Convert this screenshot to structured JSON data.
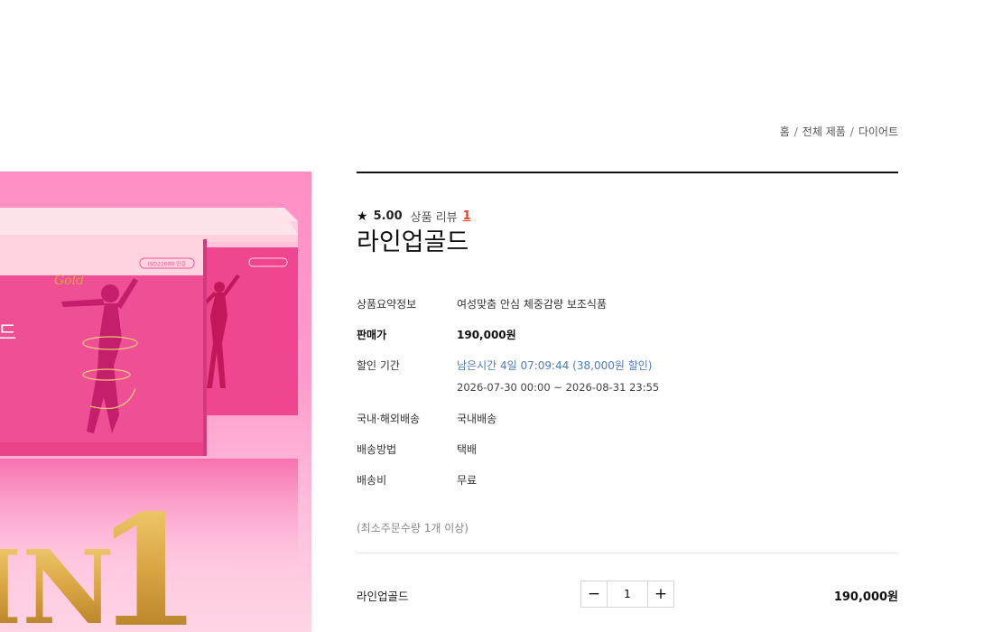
{
  "breadcrumb": [
    "홈",
    "전체 제품",
    "다이어트"
  ],
  "product": {
    "rating": "5.00",
    "review_label": "상품 리뷰",
    "review_count": "1",
    "title": "라인업골드"
  },
  "info_rows": [
    {
      "label": "상품요약정보",
      "value": "여성맞춤 안심 체중감량 보조식품"
    },
    {
      "label": "판매가",
      "value": "190,000원"
    },
    {
      "label": "할인 기간",
      "value": "남은시간 4일 07:09:44 (38,000원 할인)",
      "sub": "2026-07-30 00:00 ~ 2026-08-31 23:55"
    },
    {
      "label": "국내·해외배송",
      "value": "국내배송"
    },
    {
      "label": "배송방법",
      "value": "택배"
    },
    {
      "label": "배송비",
      "value": "무료"
    }
  ],
  "min_order": "(최소주문수량 1개 이상)",
  "option": {
    "name": "라인업골드",
    "quantity": "1",
    "minus": "−",
    "plus": "+",
    "price": "190,000원"
  },
  "image_texts": {
    "box_certified": "ISO22000 인증",
    "gold_mark": "Gold",
    "side_char": "드",
    "big_text": "IN",
    "big_number": "1"
  },
  "colors": {
    "accent_red": "#e0452b",
    "discount_blue": "#4a7bc3",
    "pink_box": "#ee4f95",
    "gold": "#d9a441"
  }
}
